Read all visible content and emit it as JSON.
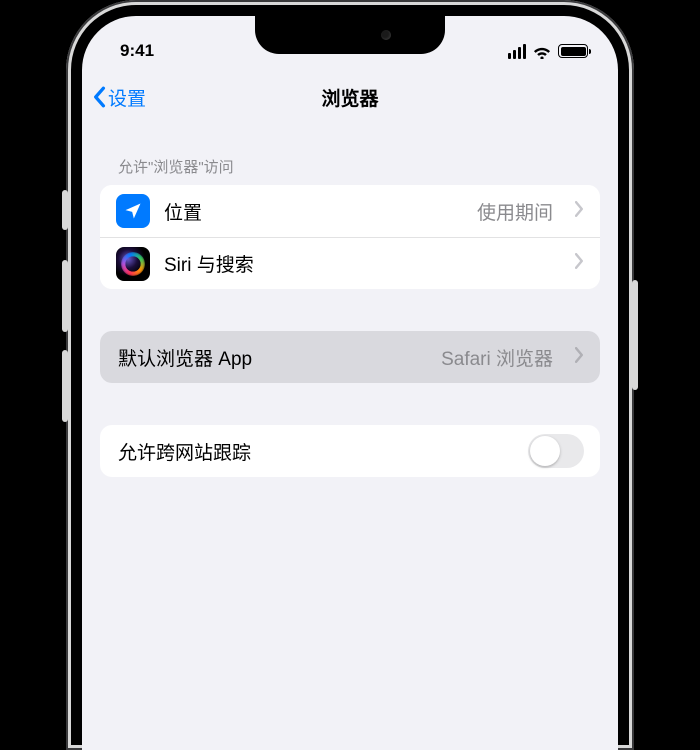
{
  "status": {
    "time": "9:41"
  },
  "nav": {
    "back": "设置",
    "title": "浏览器"
  },
  "sections": {
    "access_header": "允许\"浏览器\"访问",
    "location": {
      "label": "位置",
      "value": "使用期间"
    },
    "siri": {
      "label": "Siri 与搜索"
    },
    "default_browser": {
      "label": "默认浏览器 App",
      "value": "Safari 浏览器"
    },
    "tracking": {
      "label": "允许跨网站跟踪",
      "enabled": false
    }
  }
}
